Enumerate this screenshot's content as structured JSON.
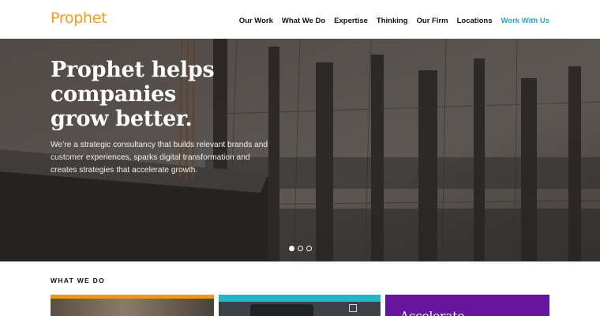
{
  "brand": {
    "logo": "Prophet",
    "accent": "#f39c1e"
  },
  "nav": {
    "items": [
      "Our Work",
      "What We Do",
      "Expertise",
      "Thinking",
      "Our Firm",
      "Locations"
    ],
    "cta": "Work With Us",
    "cta_color": "#2aa3c9"
  },
  "hero": {
    "title_lines": [
      "Prophet helps",
      "companies",
      "grow better."
    ],
    "description": "We’re a strategic consultancy that builds relevant brands and customer experiences, sparks digital transformation and creates strategies that accelerate growth.",
    "slides": 3,
    "active_slide": 1
  },
  "what_we_do": {
    "label": "WHAT WE DO",
    "cards": [
      {
        "color": "#f7941d",
        "title": ""
      },
      {
        "color": "#26b5c3",
        "title": ""
      },
      {
        "color": "#66169d",
        "title": "Accelerate"
      }
    ]
  }
}
